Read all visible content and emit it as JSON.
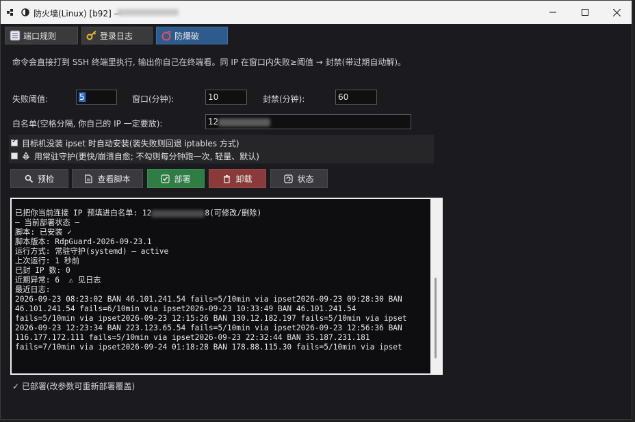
{
  "window": {
    "title": "防火墙(Linux) [b92] —",
    "minimize_label": "—",
    "maximize_label": "☐",
    "close_label": "✕"
  },
  "tabs": [
    {
      "label": "端口规则",
      "icon": "list-icon"
    },
    {
      "label": "登录日志",
      "icon": "key-icon"
    },
    {
      "label": "防爆破",
      "icon": "ring-icon",
      "active": true
    }
  ],
  "info_text": "命令会直接打到 SSH 终端里执行, 输出你自己在终端看。同 IP 在窗口内失败≥阈值 → 封禁(带过期自动解)。",
  "form": {
    "threshold_label": "失败阈值:",
    "threshold_value": "5",
    "window_label": "窗口(分钟):",
    "window_value": "10",
    "ban_label": "封禁(分钟):",
    "ban_value": "60",
    "whitelist_label": "白名单(空格分隔, 你自己的 IP 一定要放):",
    "whitelist_value": "12"
  },
  "options": {
    "auto_install_label": "目标机没装 ipset 时自动安装(装失败则回退 iptables 方式)",
    "auto_install_checked": true,
    "daemon_label": "用常驻守护(更快/崩溃自愈; 不勾则每分钟跑一次, 轻量、默认)",
    "daemon_checked": false
  },
  "buttons": {
    "precheck": "预检",
    "view_script": "查看脚本",
    "deploy": "部署",
    "uninstall": "卸载",
    "status": "状态"
  },
  "console": {
    "first_line_prefix": "已把你当前连接 IP 预填进白名单: 12",
    "first_line_suffix": "8(可修改/删除)",
    "lines": [
      "— 当前部署状态 —",
      "脚本: 已安装 ✓",
      "脚本版本: RdpGuard-2026-09-23.1",
      "运行方式: 常驻守护(systemd) — active",
      "上次运行: 1 秒前",
      "已封 IP 数: 0",
      "近期异常: 6  ⚠ 见日志",
      "最近日志:",
      "2026-09-23 08:23:02 BAN 46.101.241.54 fails=5/10min via ipset2026-09-23 09:28:30 BAN",
      "46.101.241.54 fails=6/10min via ipset2026-09-23 10:33:49 BAN 46.101.241.54",
      "fails=5/10min via ipset2026-09-23 12:15:26 BAN 130.12.182.197 fails=5/10min via ipset",
      "2026-09-23 12:23:34 BAN 223.123.65.54 fails=5/10min via ipset2026-09-23 12:56:36 BAN",
      "116.177.172.111 fails=5/10min via ipset2026-09-23 22:32:44 BAN 35.187.231.181",
      "fails=7/10min via ipset2026-09-24 01:18:28 BAN 178.88.115.30 fails=5/10min via ipset"
    ]
  },
  "status_text": "✓ 已部署(改参数可重新部署覆盖)",
  "colors": {
    "accent_tab": "#2d5b8e",
    "deploy_green": "#2f7d45",
    "uninstall_red": "#8a3a3a"
  }
}
